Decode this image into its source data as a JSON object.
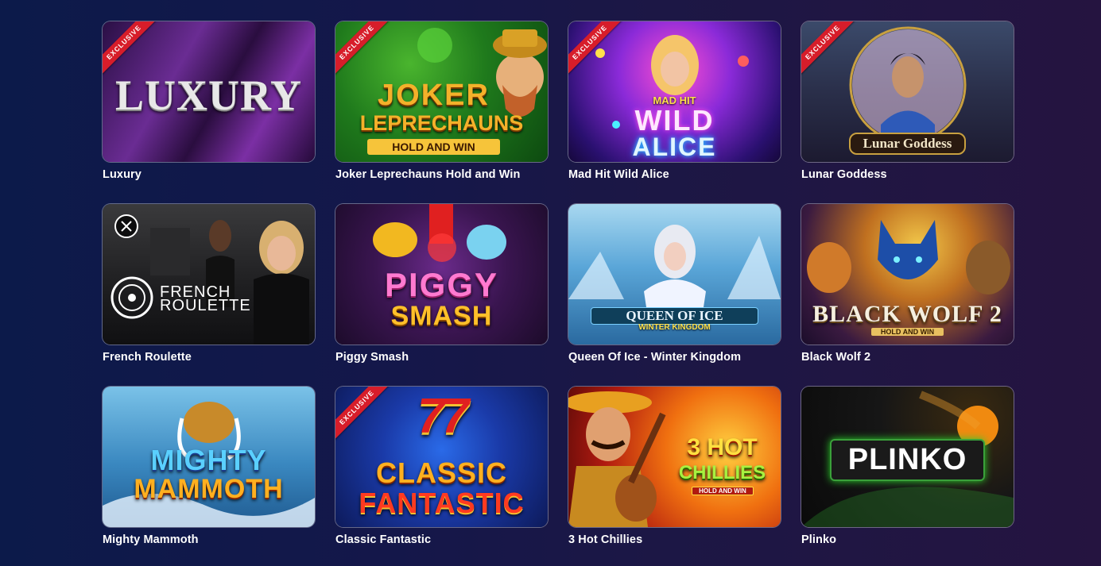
{
  "badge_exclusive": "EXCLUSIVE",
  "games": [
    {
      "title": "Luxury",
      "logo_text": "LUXURY",
      "exclusive": true
    },
    {
      "title": "Joker Leprechauns Hold and Win",
      "logo_line1": "JOKER",
      "logo_line2": "LEPRECHAUNS",
      "logo_line3": "HOLD AND WIN",
      "exclusive": true
    },
    {
      "title": "Mad Hit Wild Alice",
      "logo_line1": "MAD HIT",
      "logo_line2": "WILD",
      "logo_line3": "ALICE",
      "exclusive": true
    },
    {
      "title": "Lunar Goddess",
      "logo_text": "Lunar Goddess",
      "exclusive": true
    },
    {
      "title": "French Roulette",
      "logo_line1": "FRENCH",
      "logo_line2": "ROULETTE",
      "exclusive": false
    },
    {
      "title": "Piggy Smash",
      "logo_line1": "PIGGY",
      "logo_line2": "SMASH",
      "exclusive": false
    },
    {
      "title": "Queen Of Ice - Winter Kingdom",
      "logo_line1": "QUEEN OF ICE",
      "logo_line2": "WINTER KINGDOM",
      "exclusive": false
    },
    {
      "title": "Black Wolf 2",
      "logo_line1": "BLACK WOLF 2",
      "logo_line2": "HOLD AND WIN",
      "exclusive": false
    },
    {
      "title": "Mighty Mammoth",
      "logo_line1": "MIGHTY",
      "logo_line2": "MAMMOTH",
      "exclusive": false
    },
    {
      "title": "Classic Fantastic",
      "logo_line1": "77",
      "logo_line2": "CLASSIC",
      "logo_line3": "FANTASTIC",
      "exclusive": true
    },
    {
      "title": "3 Hot Chillies",
      "logo_line1": "3 HOT",
      "logo_line2": "CHILLIES",
      "logo_line3": "HOLD AND WIN",
      "exclusive": false
    },
    {
      "title": "Plinko",
      "logo_text": "PLINKO",
      "exclusive": false
    }
  ]
}
